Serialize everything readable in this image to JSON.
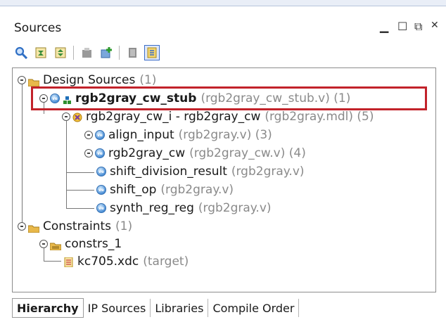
{
  "panel": {
    "title": "Sources",
    "controls": [
      "minimize-icon",
      "maximize-icon",
      "restore-icon",
      "close-icon"
    ]
  },
  "toolbar": {
    "icons": [
      "search-icon",
      "collapse-all-icon",
      "expand-all-icon",
      "properties-icon",
      "add-sources-icon",
      "document-icon",
      "show-hierarchy-icon"
    ]
  },
  "tree": {
    "design_sources": {
      "label": "Design Sources",
      "count": "(1)"
    },
    "top": {
      "label": "rgb2gray_cw_stub",
      "file": "(rgb2gray_cw_stub.v) (1)"
    },
    "inst": {
      "label": "rgb2gray_cw_i - rgb2gray_cw",
      "file": "(rgb2gray.mdl) (5)"
    },
    "children": [
      {
        "label": "align_input",
        "file": "(rgb2gray.v) (3)"
      },
      {
        "label": "rgb2gray_cw",
        "file": "(rgb2gray_cw.v) (4)"
      },
      {
        "label": "shift_division_result",
        "file": "(rgb2gray.v)"
      },
      {
        "label": "shift_op",
        "file": "(rgb2gray.v)"
      },
      {
        "label": "synth_reg_reg",
        "file": "(rgb2gray.v)"
      }
    ],
    "constraints": {
      "label": "Constraints",
      "count": "(1)"
    },
    "constrs": {
      "label": "constrs_1"
    },
    "xdc": {
      "label": "kc705.xdc",
      "note": "(target)"
    }
  },
  "tabs": [
    "Hierarchy",
    "IP Sources",
    "Libraries",
    "Compile Order"
  ],
  "colors": {
    "highlight": "#c2222a",
    "folder": "#e8b84a",
    "verilog": "#4b8fd6"
  }
}
